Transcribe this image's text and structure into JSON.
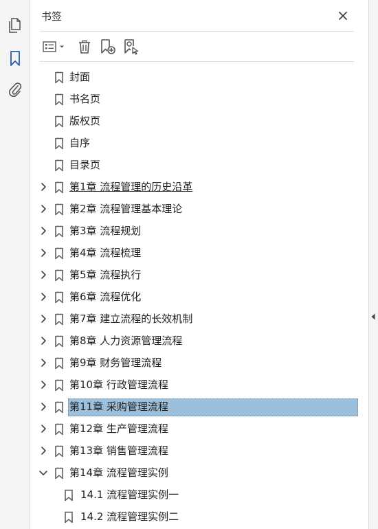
{
  "panel": {
    "title": "书签"
  },
  "icons": {
    "rail": [
      "pages-icon",
      "bookmark-icon",
      "paperclip-icon"
    ],
    "toolbar": [
      "options-icon",
      "trash-icon",
      "new-bookmark-icon",
      "find-bookmark-icon"
    ],
    "close": "close-icon"
  },
  "colors": {
    "accent": "#1f5fa8",
    "selection": "#9cc0dc",
    "icon": "#555555"
  },
  "bookmarks": [
    {
      "label": "封面",
      "level": 0,
      "expandable": false
    },
    {
      "label": "书名页",
      "level": 0,
      "expandable": false
    },
    {
      "label": "版权页",
      "level": 0,
      "expandable": false
    },
    {
      "label": "自序",
      "level": 0,
      "expandable": false
    },
    {
      "label": "目录页",
      "level": 0,
      "expandable": false
    },
    {
      "label": "第1章  流程管理的历史沿革",
      "level": 0,
      "expandable": true,
      "expanded": false,
      "underlined": true
    },
    {
      "label": "第2章  流程管理基本理论",
      "level": 0,
      "expandable": true,
      "expanded": false
    },
    {
      "label": "第3章  流程规划",
      "level": 0,
      "expandable": true,
      "expanded": false
    },
    {
      "label": "第4章  流程梳理",
      "level": 0,
      "expandable": true,
      "expanded": false
    },
    {
      "label": "第5章  流程执行",
      "level": 0,
      "expandable": true,
      "expanded": false
    },
    {
      "label": "第6章  流程优化",
      "level": 0,
      "expandable": true,
      "expanded": false
    },
    {
      "label": "第7章  建立流程的长效机制",
      "level": 0,
      "expandable": true,
      "expanded": false
    },
    {
      "label": "第8章  人力资源管理流程",
      "level": 0,
      "expandable": true,
      "expanded": false
    },
    {
      "label": "第9章  财务管理流程",
      "level": 0,
      "expandable": true,
      "expanded": false
    },
    {
      "label": "第10章  行政管理流程",
      "level": 0,
      "expandable": true,
      "expanded": false
    },
    {
      "label": "第11章  采购管理流程",
      "level": 0,
      "expandable": true,
      "expanded": false,
      "selected": true
    },
    {
      "label": "第12章  生产管理流程",
      "level": 0,
      "expandable": true,
      "expanded": false
    },
    {
      "label": "第13章  销售管理流程",
      "level": 0,
      "expandable": true,
      "expanded": false
    },
    {
      "label": "第14章  流程管理实例",
      "level": 0,
      "expandable": true,
      "expanded": true
    },
    {
      "label": "14.1  流程管理实例一",
      "level": 1,
      "expandable": false
    },
    {
      "label": "14.2  流程管理实例二",
      "level": 1,
      "expandable": false
    }
  ]
}
